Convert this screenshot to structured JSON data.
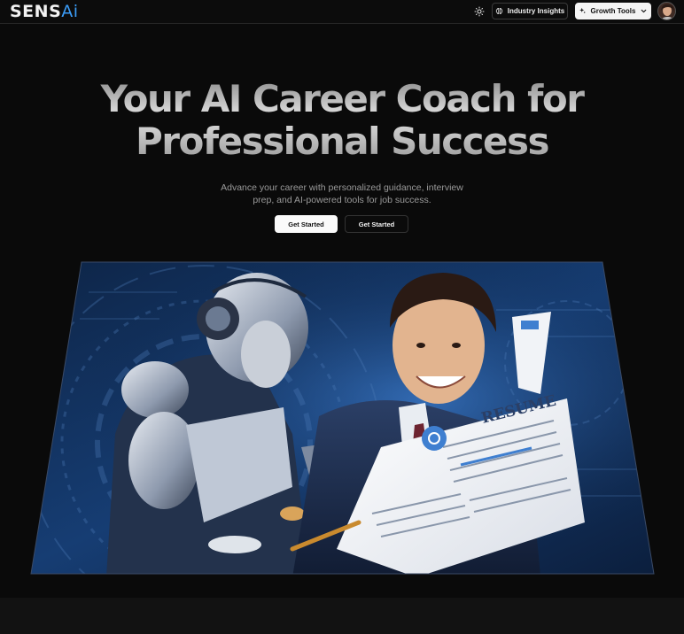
{
  "navbar": {
    "logo_main": "SENS",
    "logo_accent": "Ai",
    "theme_toggle_icon": "sun-icon",
    "insights_icon": "brain-icon",
    "insights_label": "Industry Insights",
    "growth_icon": "sparkle-icon",
    "growth_label": "Growth Tools",
    "growth_chevron_icon": "chevron-down-icon",
    "avatar_alt": "user-avatar"
  },
  "hero": {
    "title_line1": "Your AI Career Coach for",
    "title_line2": "Professional Success",
    "subtitle": "Advance your career with personalized guidance, interview prep, and AI-powered tools for job success.",
    "primary_button": "Get Started",
    "secondary_button": "Get Started"
  },
  "banner": {
    "resume_heading": "RESUME",
    "image_description_icon": "ai-robot-and-professional-illustration"
  },
  "colors": {
    "background": "#0a0a0a",
    "logo_accent": "#3b9cf6",
    "banner_blue": "#1d4f8f"
  }
}
